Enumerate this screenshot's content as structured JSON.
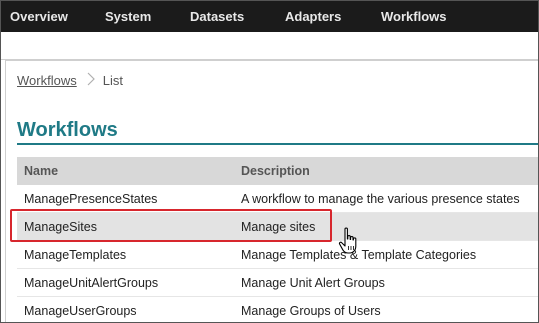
{
  "topnav": {
    "items": [
      "Overview",
      "System",
      "Datasets",
      "Adapters",
      "Workflows"
    ]
  },
  "breadcrumb": {
    "link": "Workflows",
    "current": "List"
  },
  "page": {
    "title": "Workflows"
  },
  "table": {
    "headers": [
      "Name",
      "Description"
    ],
    "rows": [
      {
        "name": "ManagePresenceStates",
        "description": "A workflow to manage the various presence states"
      },
      {
        "name": "ManageSites",
        "description": "Manage sites"
      },
      {
        "name": "ManageTemplates",
        "description": "Manage Templates & Template Categories"
      },
      {
        "name": "ManageUnitAlertGroups",
        "description": "Manage Unit Alert Groups"
      },
      {
        "name": "ManageUserGroups",
        "description": "Manage Groups of Users"
      }
    ]
  },
  "colors": {
    "accent": "#1f7a86",
    "nav_bg": "#1b1b1b",
    "highlight": "#d7262d"
  },
  "icons": [
    "hand-pointer-icon",
    "chevron-right-icon"
  ]
}
